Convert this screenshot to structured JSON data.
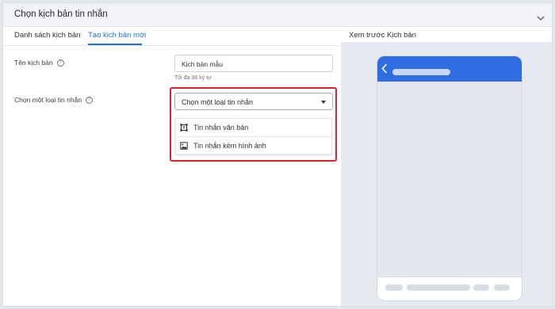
{
  "header": {
    "title": "Chọn kịch bản tin nhắn"
  },
  "tabs": [
    {
      "label": "Danh sách kịch bản",
      "active": false
    },
    {
      "label": "Tạo kịch bản mới",
      "active": true
    }
  ],
  "form": {
    "name_label": "Tên kịch bản",
    "name_value": "Kịch bản mẫu",
    "name_hint": "Tối đa 38 ký tự",
    "type_label": "Chọn một loại tin nhắn",
    "type_placeholder": "Chọn một loại tin nhắn",
    "type_options": [
      {
        "label": "Tin nhắn văn bản",
        "icon": "text-icon"
      },
      {
        "label": "Tin nhắn kèm hình ảnh",
        "icon": "image-icon"
      }
    ]
  },
  "preview": {
    "title": "Xem trước Kịch bản"
  },
  "colors": {
    "accent": "#1e6fe0",
    "highlight": "#e5202e",
    "phone_header": "#2f6ee2"
  }
}
